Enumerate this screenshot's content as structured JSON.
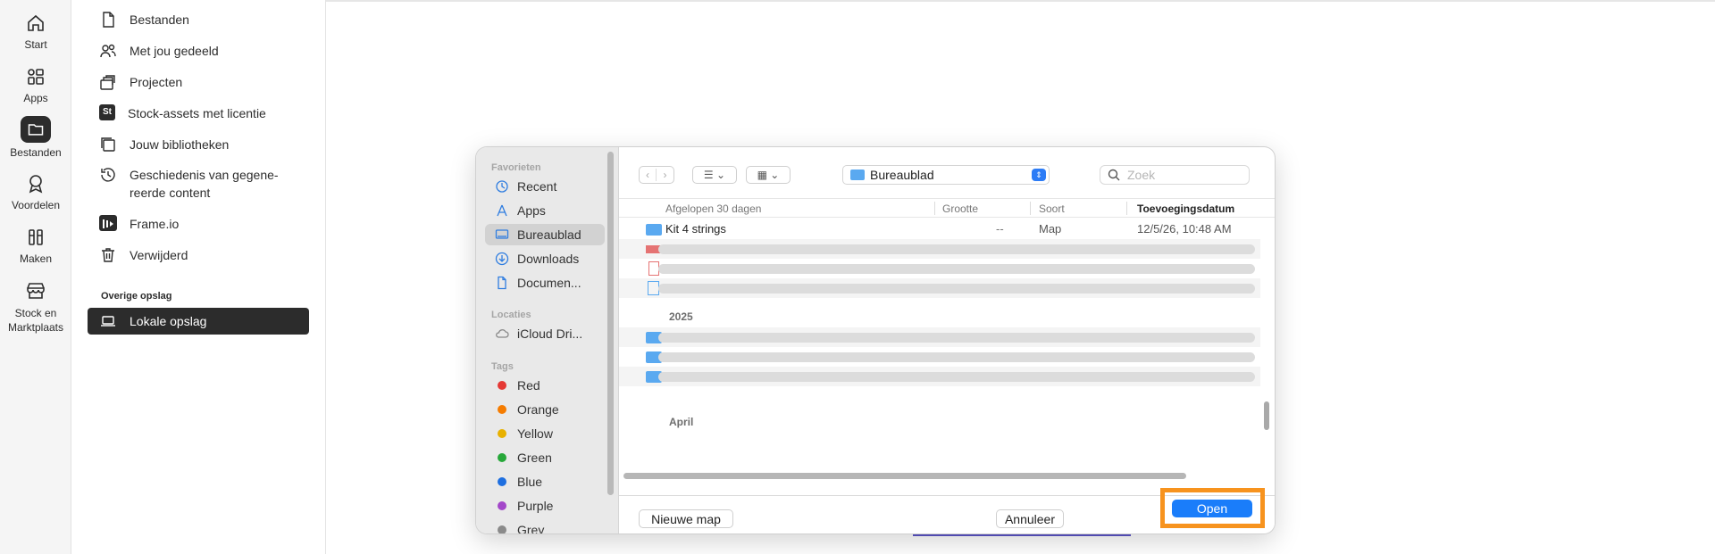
{
  "rail": [
    {
      "label": "Start",
      "icon": "home-icon"
    },
    {
      "label": "Apps",
      "icon": "apps-icon"
    },
    {
      "label": "Bestanden",
      "icon": "folder-icon",
      "active": true
    },
    {
      "label": "Voordelen",
      "icon": "award-icon"
    },
    {
      "label": "Maken",
      "icon": "create-icon"
    },
    {
      "label": "Stock en Marktplaats",
      "icon": "store-icon"
    }
  ],
  "nav": {
    "items": [
      {
        "label": "Bestanden",
        "icon": "file-icon"
      },
      {
        "label": "Met jou gedeeld",
        "icon": "people-icon"
      },
      {
        "label": "Projecten",
        "icon": "projects-icon"
      },
      {
        "label": "Stock-assets met licentie",
        "icon": "stock-icon",
        "badge": "St"
      },
      {
        "label": "Jouw bibliotheken",
        "icon": "library-icon"
      },
      {
        "label": "Geschiedenis van gegene-reerde content",
        "icon": "history-icon"
      },
      {
        "label": "Frame.io",
        "icon": "frameio-icon"
      },
      {
        "label": "Verwijderd",
        "icon": "trash-icon"
      }
    ],
    "other_storage_heading": "Overige opslag",
    "local_storage": "Lokale opslag"
  },
  "dialog": {
    "sidebar": {
      "favorites_heading": "Favorieten",
      "favorites": [
        {
          "label": "Recent",
          "icon": "clock-icon"
        },
        {
          "label": "Apps",
          "icon": "apps-icon"
        },
        {
          "label": "Bureaublad",
          "icon": "desktop-icon",
          "selected": true
        },
        {
          "label": "Downloads",
          "icon": "download-icon"
        },
        {
          "label": "Documen...",
          "icon": "document-icon"
        }
      ],
      "locations_heading": "Locaties",
      "locations": [
        {
          "label": "iCloud Dri...",
          "icon": "cloud-icon"
        }
      ],
      "tags_heading": "Tags",
      "tags": [
        {
          "label": "Red",
          "color": "#e53935"
        },
        {
          "label": "Orange",
          "color": "#f57c00"
        },
        {
          "label": "Yellow",
          "color": "#e8b100"
        },
        {
          "label": "Green",
          "color": "#27a83a"
        },
        {
          "label": "Blue",
          "color": "#1e6fe0"
        },
        {
          "label": "Purple",
          "color": "#a347c9"
        },
        {
          "label": "Grey",
          "color": "#8a8a8a"
        }
      ]
    },
    "location": "Bureaublad",
    "search_placeholder": "Zoek",
    "columns": {
      "name": "Afgelopen 30 dagen",
      "size": "Grootte",
      "kind": "Soort",
      "date": "Toevoegingsdatum"
    },
    "first_row": {
      "name": "Kit 4 strings",
      "size": "--",
      "kind": "Map",
      "date": "12/5/26, 10:48 AM"
    },
    "groups": [
      "2025",
      "April"
    ],
    "buttons": {
      "new_folder": "Nieuwe map",
      "cancel": "Annuleer",
      "open": "Open"
    }
  }
}
